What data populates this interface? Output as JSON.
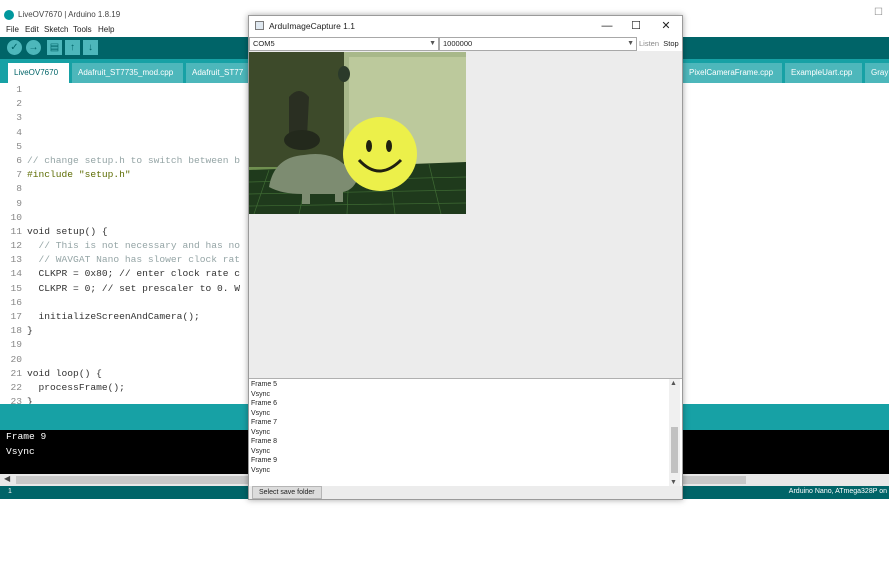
{
  "ide": {
    "title": "LiveOV7670 | Arduino 1.8.19",
    "menu": [
      "File",
      "Edit",
      "Sketch",
      "Tools",
      "Help"
    ],
    "toolbar": {
      "verify_icon": "check-icon",
      "upload_icon": "arrow-right-icon",
      "new_icon": "new-file-icon",
      "open_icon": "arrow-up-icon",
      "save_icon": "arrow-down-icon"
    },
    "tabs": [
      {
        "label": "LiveOV7670"
      },
      {
        "label": "Adafruit_ST7735_mod.cpp"
      },
      {
        "label": "Adafruit_ST77"
      },
      {
        "label": "PixelCameraFrame.cpp"
      },
      {
        "label": "ExampleUart.cpp"
      },
      {
        "label": "Gray"
      }
    ],
    "line_numbers": [
      "1",
      "2",
      "3",
      "4",
      "5",
      "6",
      "7",
      "8",
      "9",
      "10",
      "11",
      "12",
      "13",
      "14",
      "15",
      "16",
      "17",
      "18",
      "19",
      "20",
      "21",
      "22",
      "23"
    ],
    "code_lines": [
      "",
      "",
      "",
      "",
      "",
      "// change setup.h to switch between b",
      "#include \"setup.h\"",
      "",
      "",
      "",
      "void setup() {",
      "  // This is not necessary and has no",
      "  // WAVGAT Nano has slower clock rat",
      "  CLKPR = 0x80; // enter clock rate c",
      "  CLKPR = 0; // set prescaler to 0. W",
      "",
      "  initializeScreenAndCamera();",
      "}",
      "",
      "",
      "void loop() {",
      "  processFrame();",
      "}"
    ],
    "console_lines": [
      "Frame 9",
      "Vsync"
    ],
    "status_line": "1",
    "board": "Arduino Nano, ATmega328P on"
  },
  "capture": {
    "title": "ArduImageCapture 1.1",
    "window_buttons": {
      "minimize": "—",
      "maximize": "☐",
      "close": "✕"
    },
    "port": "COM5",
    "baud": "1000000",
    "listen_label": "Listen",
    "stop_label": "Stop",
    "log_lines": [
      "Frame 5",
      "Vsync",
      "Frame 6",
      "Vsync",
      "Frame 7",
      "Vsync",
      "Frame 8",
      "Vsync",
      "Frame 9",
      "Vsync"
    ],
    "save_button": "Select save folder"
  },
  "colors": {
    "arduino_teal_dark": "#006468",
    "arduino_teal": "#17a1a5",
    "arduino_teal_light": "#4db7bb",
    "console_bg": "#000000"
  }
}
